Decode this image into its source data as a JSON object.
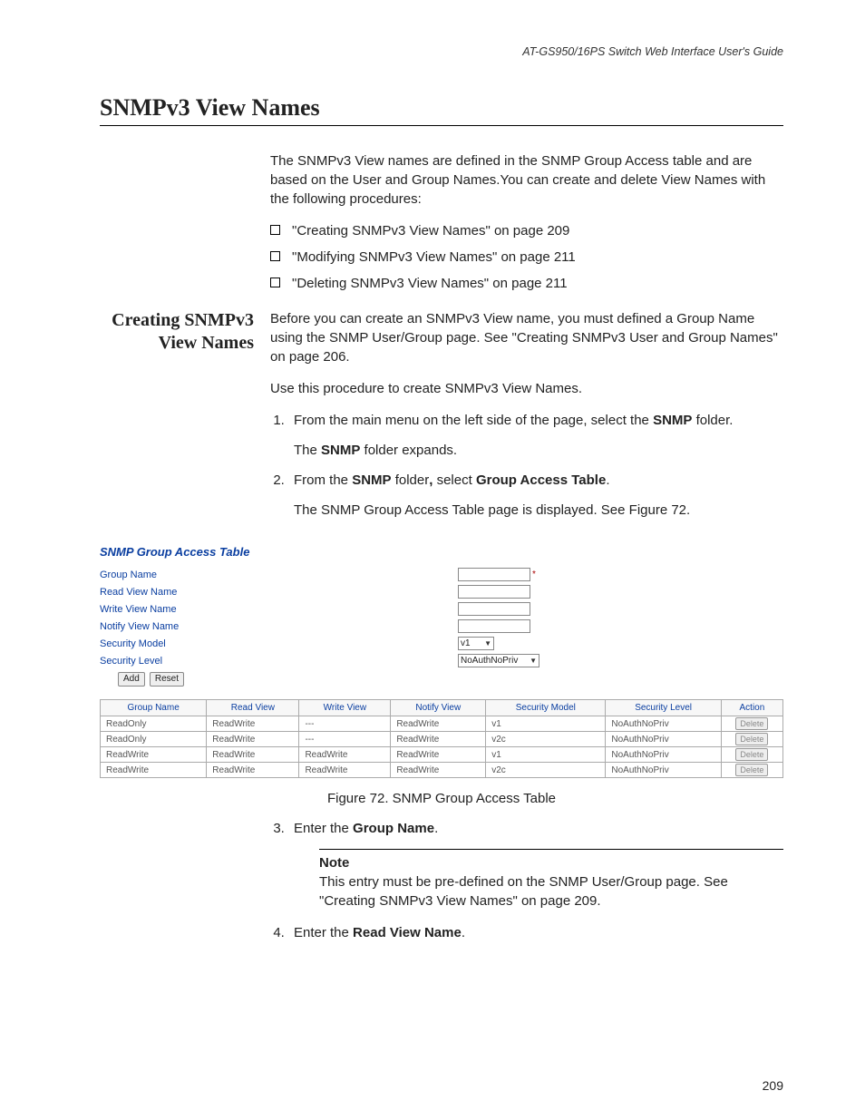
{
  "running_head": "AT-GS950/16PS Switch Web Interface User's Guide",
  "section_title": "SNMPv3 View Names",
  "intro": "The SNMPv3 View names are defined in the SNMP Group Access table and are based on the User and Group Names.You can create and delete View Names with the following procedures:",
  "toc": [
    "\"Creating SNMPv3 View Names\" on page 209",
    "\"Modifying SNMPv3 View Names\" on page 211",
    "\"Deleting SNMPv3 View Names\" on page 211"
  ],
  "sub_heading": "Creating SNMPv3 View Names",
  "sub_p1": "Before you can create an SNMPv3 View name, you must defined a Group Name using the SNMP User/Group page. See \"Creating SNMPv3 User and Group Names\" on page 206.",
  "sub_p2": "Use this procedure to create SNMPv3 View Names.",
  "steps": {
    "s1a": "From the main menu on the left side of the page, select the ",
    "s1b": "SNMP",
    "s1c": " folder.",
    "s1d": "The ",
    "s1e": "SNMP",
    "s1f": " folder expands.",
    "s2a": "From the ",
    "s2b": "SNMP",
    "s2c": " folder",
    "s2d": ",",
    "s2e": " select ",
    "s2f": "Group Access Table",
    "s2g": ".",
    "s2h": "The SNMP Group Access Table page is displayed. See Figure 72.",
    "s3a": "Enter the ",
    "s3b": "Group Name",
    "s3c": ".",
    "s4a": "Enter the ",
    "s4b": "Read View Name",
    "s4c": "."
  },
  "note_label": "Note",
  "note_body": "This entry must be pre-defined on the SNMP User/Group page. See \"Creating SNMPv3 View Names\" on page 209.",
  "figure": {
    "panel_title": "SNMP Group Access Table",
    "labels": {
      "group_name": "Group Name",
      "read_view": "Read View Name",
      "write_view": "Write View Name",
      "notify_view": "Notify View Name",
      "sec_model": "Security Model",
      "sec_level": "Security Level"
    },
    "sec_model_value": "v1",
    "sec_level_value": "NoAuthNoPriv",
    "add_btn": "Add",
    "reset_btn": "Reset",
    "headers": [
      "Group Name",
      "Read View",
      "Write View",
      "Notify View",
      "Security Model",
      "Security Level",
      "Action"
    ],
    "rows": [
      {
        "c": [
          "ReadOnly",
          "ReadWrite",
          "---",
          "ReadWrite",
          "v1",
          "NoAuthNoPriv"
        ],
        "action": "Delete"
      },
      {
        "c": [
          "ReadOnly",
          "ReadWrite",
          "---",
          "ReadWrite",
          "v2c",
          "NoAuthNoPriv"
        ],
        "action": "Delete"
      },
      {
        "c": [
          "ReadWrite",
          "ReadWrite",
          "ReadWrite",
          "ReadWrite",
          "v1",
          "NoAuthNoPriv"
        ],
        "action": "Delete"
      },
      {
        "c": [
          "ReadWrite",
          "ReadWrite",
          "ReadWrite",
          "ReadWrite",
          "v2c",
          "NoAuthNoPriv"
        ],
        "action": "Delete"
      }
    ],
    "caption": "Figure 72. SNMP Group Access Table"
  },
  "page_number": "209"
}
